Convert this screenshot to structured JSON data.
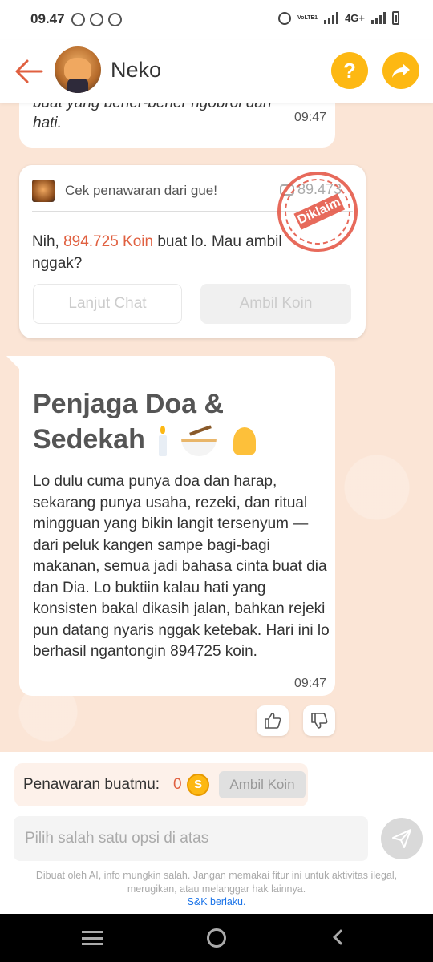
{
  "status_bar": {
    "time": "09.47",
    "network": "4G+",
    "volte": "VoLTE1"
  },
  "header": {
    "title": "Neko",
    "help_glyph": "?",
    "share_glyph": "➦"
  },
  "messages": {
    "m1": {
      "text_line1": "buat yang bener-bener ngobrol dari",
      "text_line2": "hati.",
      "time": "09:47"
    },
    "offer": {
      "header": "Cek penawaran dari gue!",
      "coin_count": "89.473",
      "stamp": "Diklaim",
      "body_prefix": "Nih, ",
      "amount": "894.725 Koin",
      "body_suffix": " buat lo. Mau ambil nggak?",
      "btn_continue": "Lanjut Chat",
      "btn_take": "Ambil Koin"
    },
    "m3": {
      "title": "Penjaga Doa & Sedekah",
      "body": "Lo dulu cuma punya doa dan harap, sekarang punya usaha, rezeki, dan ritual mingguan yang bikin langit tersenyum — dari peluk kangen sampe bagi-bagi makanan, semua jadi bahasa cinta buat dia dan Dia. Lo buktiin kalau hati yang konsisten bakal dikasih jalan, bahkan rejeki pun datang nyaris nggak ketebak. Hari ini lo berhasil ngantongin 894725 koin.",
      "time": "09:47"
    }
  },
  "bottom": {
    "offer_label": "Penawaran buatmu:",
    "offer_count": "0",
    "coin_glyph": "S",
    "take_btn": "Ambil Koin",
    "input_placeholder": "Pilih salah satu opsi di atas",
    "disclaimer": "Dibuat oleh AI, info mungkin salah. Jangan memakai fitur ini untuk aktivitas ilegal, merugikan, atau melanggar hak lainnya.",
    "tos": "S&K berlaku."
  },
  "colors": {
    "accent": "#e06040",
    "yellow": "#fdb813",
    "background": "#fbe5d6"
  },
  "icons": [
    "back-arrow-icon",
    "help-icon",
    "share-icon",
    "thumbs-up-icon",
    "thumbs-down-icon",
    "send-icon",
    "coin-icon"
  ]
}
